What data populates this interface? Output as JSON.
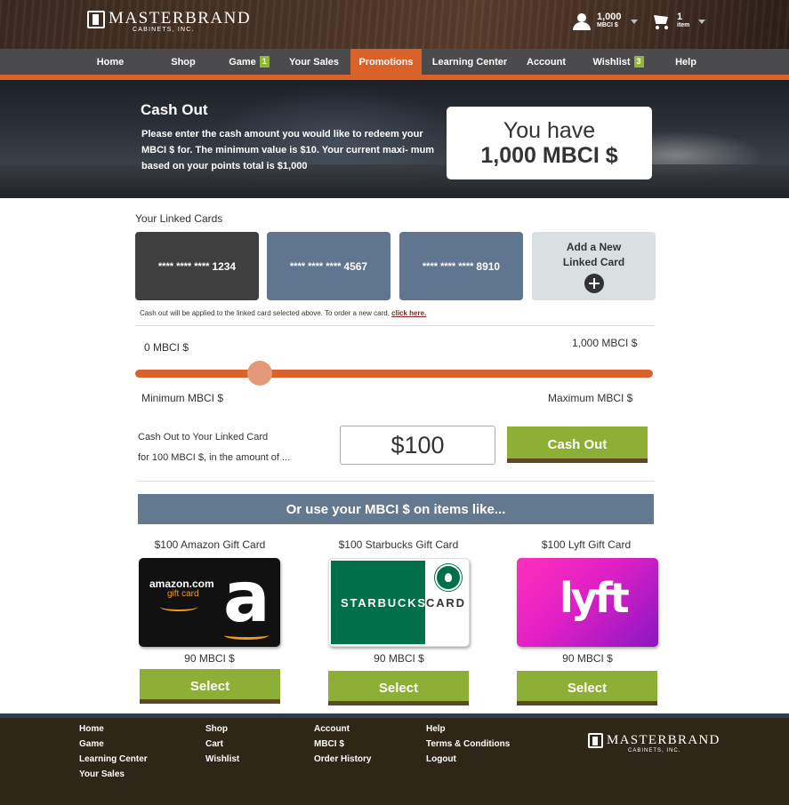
{
  "brand": {
    "name": "MASTERBRAND",
    "sub": "CABINETS, INC."
  },
  "header": {
    "points": {
      "value": "1,000",
      "unit": "MBCI $"
    },
    "cart": {
      "count": "1",
      "unit": "item"
    }
  },
  "nav": {
    "items": [
      {
        "label": "Home",
        "badge": ""
      },
      {
        "label": "Shop",
        "badge": ""
      },
      {
        "label": "Game",
        "badge": "1"
      },
      {
        "label": "Your Sales",
        "badge": ""
      },
      {
        "label": "Promotions",
        "badge": ""
      },
      {
        "label": "Learning Center",
        "badge": ""
      },
      {
        "label": "Account",
        "badge": ""
      },
      {
        "label": "Wishlist",
        "badge": "3"
      },
      {
        "label": "Help",
        "badge": ""
      }
    ],
    "active": "Promotions"
  },
  "hero": {
    "title": "Cash Out",
    "description": "Please enter the cash amount you would like to redeem your MBCI $ for. The minimum value is $10. Your current maxi- mum based on your points total is $1,000",
    "balance_line1": "You have",
    "balance_line2": "1,000 MBCI $"
  },
  "linked_cards": {
    "label": "Your Linked Cards",
    "cards": [
      {
        "mask": "**** **** ****",
        "last4": "1234",
        "selected": true
      },
      {
        "mask": "**** **** ****",
        "last4": "4567",
        "selected": false
      },
      {
        "mask": "**** **** ****",
        "last4": "8910",
        "selected": false
      }
    ],
    "add_line1": "Add a New",
    "add_line2": "Linked Card",
    "note": "Cash out will be applied to the linked card selected above. To order a new card,",
    "note_link": "click here."
  },
  "slider": {
    "min_value": "0 MBCI $",
    "max_value": "1,000 MBCI $",
    "min_label": "Minimum MBCI $",
    "max_label": "Maximum MBCI $",
    "position": 0.24
  },
  "cashout": {
    "line1": "Cash Out to Your Linked Card",
    "line2": "for 100 MBCI $, in the amount of ...",
    "amount": "$100",
    "button": "Cash Out"
  },
  "banner": "Or use your MBCI $ on items like...",
  "gift_cards": [
    {
      "title": "$100 Amazon Gift Card",
      "price": "90 MBCI $",
      "button": "Select",
      "brand_text": "amazon.com",
      "brand_sub": "gift card",
      "glyph": "a"
    },
    {
      "title": "$100 Starbucks Gift Card",
      "price": "90 MBCI $",
      "button": "Select",
      "brand_text": "STARBUCKS",
      "brand_sub": "CARD"
    },
    {
      "title": "$100 Lyft Gift Card",
      "price": "90 MBCI $",
      "button": "Select",
      "brand_text": "lyft"
    }
  ],
  "footer": {
    "col1": [
      "Home",
      "Game",
      "Learning Center",
      "Your Sales"
    ],
    "col2": [
      "Shop",
      "Cart",
      "Wishlist"
    ],
    "col3": [
      "Account",
      "MBCI $",
      "Order History"
    ],
    "col4": [
      "Help",
      "Terms & Conditions",
      "Logout"
    ]
  },
  "colors": {
    "accent_orange": "#d9612a",
    "nav_gray": "#4b4b4d",
    "button_green": "#8daf35",
    "banner_blue": "#62798f",
    "footer_brown": "#2e2617"
  }
}
